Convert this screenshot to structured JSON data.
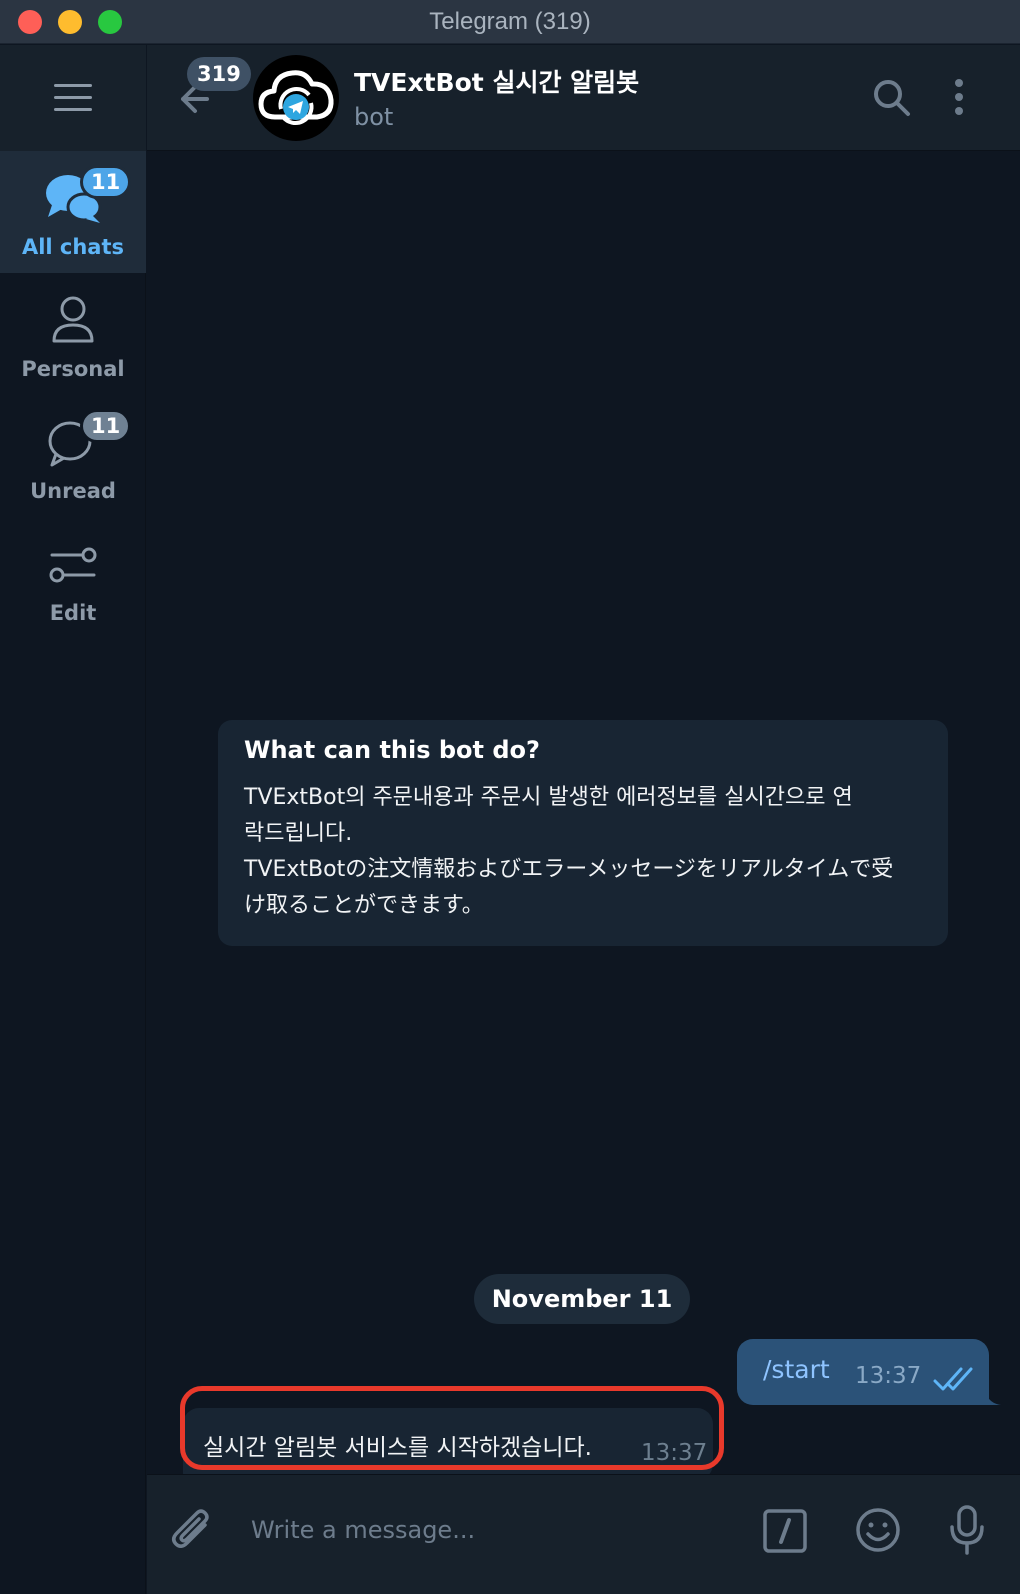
{
  "window": {
    "title": "Telegram (319)"
  },
  "sidebar": {
    "folders": [
      {
        "label": "All chats",
        "badge": "11",
        "active": true
      },
      {
        "label": "Personal",
        "badge": ""
      },
      {
        "label": "Unread",
        "badge": "11"
      },
      {
        "label": "Edit",
        "badge": ""
      }
    ]
  },
  "header": {
    "unread_count": "319",
    "chat_title": "TVExtBot 실시간 알림봇",
    "chat_status": "bot"
  },
  "bot_info": {
    "heading": "What can this bot do?",
    "description": "TVExtBot의 주문내용과 주문시 발생한 에러정보를 실시간으로 연\n락드립니다.\nTVExtBotの注文情報およびエラーメッセージをリアルタイムで受\nけ取ることができます。"
  },
  "date_separator": "November 11",
  "messages": [
    {
      "direction": "out",
      "text": "/start",
      "time": "13:37",
      "read": true
    },
    {
      "direction": "in",
      "text": "실시간 알림봇 서비스를 시작하겠습니다.",
      "time": "13:37",
      "highlighted": true
    }
  ],
  "composer": {
    "placeholder": "Write a message..."
  },
  "colors": {
    "accent": "#5eb5f7",
    "highlight": "#e8392b"
  }
}
